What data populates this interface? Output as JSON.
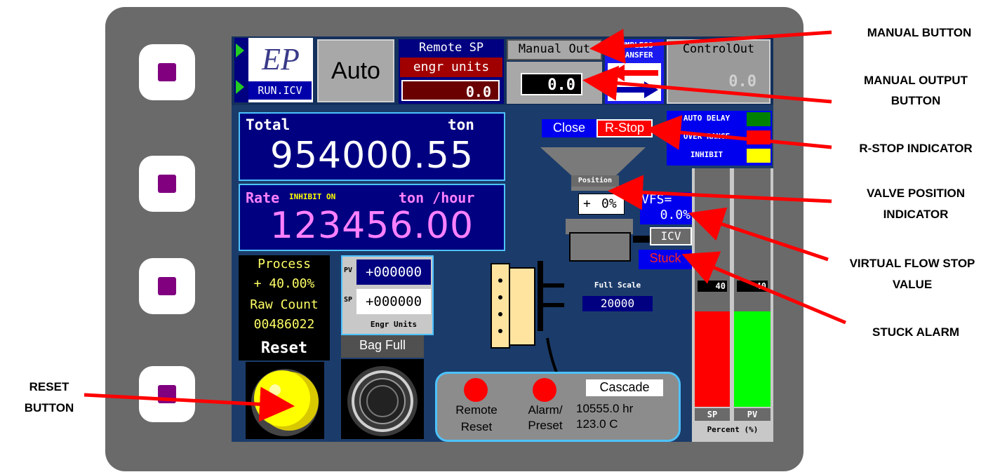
{
  "header": {
    "logo_text": "EP",
    "run_label": "RUN.ICV",
    "mode": "Auto",
    "remote_sp_label": "Remote SP",
    "engr_units_label": "engr units",
    "remote_sp_value": "0.0",
    "manual_out_label": "Manual Out",
    "manual_out_value": "0.0",
    "bumpless_line1": "BUMPLESS",
    "bumpless_line2": "TRANSFER",
    "control_out_label": "ControlOut",
    "control_out_value": "0.0"
  },
  "total": {
    "label": "Total",
    "unit": "ton",
    "value": "954000.55"
  },
  "rate": {
    "label": "Rate",
    "inhibit": "INHIBIT ON",
    "unit": "ton /hour",
    "value": "123456.00"
  },
  "process": {
    "label": "Process",
    "value": "+ 40.00%",
    "raw_label": "Raw Count",
    "raw_value": "00486022"
  },
  "reset_label": "Reset",
  "pv_sp": {
    "pv_tag": "PV",
    "pv_value": "+000000",
    "sp_tag": "SP",
    "sp_value": "+000000",
    "units": "Engr Units"
  },
  "bag_full_label": "Bag Full",
  "valve": {
    "close_label": "Close",
    "rstop_label": "R-Stop",
    "position_label": "Position",
    "position_sign": "+",
    "position_value": "0%",
    "vfs_label": "VFS=",
    "vfs_value": "0.0%",
    "icv_label": "ICV",
    "stuck_label": "Stuck",
    "full_scale_label": "Full Scale",
    "full_scale_value": "20000"
  },
  "indicators": [
    {
      "label": "AUTO DELAY",
      "color": "#008000"
    },
    {
      "label": "OVER RANGE",
      "color": "#ff0000"
    },
    {
      "label": "INHIBIT",
      "color": "#ffff00"
    }
  ],
  "bars": {
    "sp": {
      "tag": "SP",
      "tick": "40",
      "fill_percent": 40,
      "color": "#ff0000"
    },
    "pv": {
      "tag": "PV",
      "tick": "40",
      "fill_percent": 40,
      "color": "#00ff00"
    },
    "caption": "Percent (%)"
  },
  "status_panel": {
    "remote_label": "Remote",
    "reset_label": "Reset",
    "alarm_label": "Alarm/",
    "preset_label": "Preset",
    "cascade_label": "Cascade",
    "hours": "10555.0 hr",
    "temperature": "123.0 C"
  },
  "annotations": {
    "manual_button": "MANUAL BUTTON",
    "manual_output_line1": "MANUAL OUTPUT",
    "manual_output_line2": "BUTTON",
    "rstop": "R-STOP INDICATOR",
    "valve_line1": "VALVE POSITION",
    "valve_line2": "INDICATOR",
    "vfs_line1": "VIRTUAL FLOW STOP",
    "vfs_line2": "VALUE",
    "stuck": "STUCK ALARM",
    "reset_line1": "RESET",
    "reset_line2": "BUTTON"
  },
  "colors": {
    "screen_bg": "#1b3c6a",
    "panel_navy": "#000080",
    "arrow_red": "#ff0000",
    "key_purple": "#800080"
  }
}
